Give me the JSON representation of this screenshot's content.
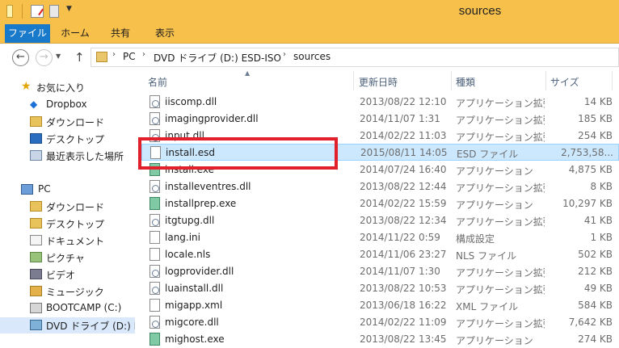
{
  "window": {
    "title": "sources"
  },
  "ribbon": {
    "tabs": [
      {
        "label": "ファイル"
      },
      {
        "label": "ホーム"
      },
      {
        "label": "共有"
      },
      {
        "label": "表示"
      }
    ]
  },
  "address": {
    "crumbs": [
      "PC",
      "DVD ドライブ (D:) ESD-ISO",
      "sources"
    ]
  },
  "nav": {
    "items": [
      {
        "label": "お気に入り",
        "icon": "star-icon"
      },
      {
        "label": "Dropbox",
        "icon": "dropbox-icon"
      },
      {
        "label": "ダウンロード",
        "icon": "folder-icon"
      },
      {
        "label": "デスクトップ",
        "icon": "desktop-icon"
      },
      {
        "label": "最近表示した場所",
        "icon": "recent-places-icon"
      },
      {
        "label": "PC",
        "icon": "pc-icon"
      },
      {
        "label": "ダウンロード",
        "icon": "folder-icon"
      },
      {
        "label": "デスクトップ",
        "icon": "desktop-icon"
      },
      {
        "label": "ドキュメント",
        "icon": "documents-icon"
      },
      {
        "label": "ピクチャ",
        "icon": "pictures-icon"
      },
      {
        "label": "ビデオ",
        "icon": "videos-icon"
      },
      {
        "label": "ミュージック",
        "icon": "music-icon"
      },
      {
        "label": "BOOTCAMP (C:)",
        "icon": "drive-icon"
      },
      {
        "label": "DVD ドライブ (D:) ES",
        "icon": "dvd-drive-icon"
      }
    ]
  },
  "columns": {
    "name": "名前",
    "date": "更新日時",
    "type": "種類",
    "size": "サイズ"
  },
  "files": [
    {
      "name": "iiscomp.dll",
      "date": "2013/08/22 12:10",
      "type": "アプリケーション拡張",
      "size": "14 KB",
      "icon": "dll"
    },
    {
      "name": "imagingprovider.dll",
      "date": "2014/11/07 1:31",
      "type": "アプリケーション拡張",
      "size": "185 KB",
      "icon": "dll"
    },
    {
      "name": "input.dll",
      "date": "2014/02/22 11:03",
      "type": "アプリケーション拡張",
      "size": "254 KB",
      "icon": "dll"
    },
    {
      "name": "install.esd",
      "date": "2015/08/11 14:05",
      "type": "ESD ファイル",
      "size": "2,753,58...",
      "icon": "file"
    },
    {
      "name": "install.exe",
      "date": "2014/07/24 16:40",
      "type": "アプリケーション",
      "size": "4,875 KB",
      "icon": "exe"
    },
    {
      "name": "installeventres.dll",
      "date": "2013/08/22 12:44",
      "type": "アプリケーション拡張",
      "size": "8 KB",
      "icon": "dll"
    },
    {
      "name": "installprep.exe",
      "date": "2014/02/22 15:59",
      "type": "アプリケーション",
      "size": "10,297 KB",
      "icon": "exe"
    },
    {
      "name": "itgtupg.dll",
      "date": "2013/08/22 12:34",
      "type": "アプリケーション拡張",
      "size": "41 KB",
      "icon": "dll"
    },
    {
      "name": "lang.ini",
      "date": "2014/11/22 0:59",
      "type": "構成設定",
      "size": "1 KB",
      "icon": "ini"
    },
    {
      "name": "locale.nls",
      "date": "2014/11/06 23:27",
      "type": "NLS ファイル",
      "size": "502 KB",
      "icon": "file"
    },
    {
      "name": "logprovider.dll",
      "date": "2014/11/07 1:30",
      "type": "アプリケーション拡張",
      "size": "212 KB",
      "icon": "dll"
    },
    {
      "name": "luainstall.dll",
      "date": "2013/08/22 10:53",
      "type": "アプリケーション拡張",
      "size": "49 KB",
      "icon": "dll"
    },
    {
      "name": "migapp.xml",
      "date": "2013/06/18 16:22",
      "type": "XML ファイル",
      "size": "584 KB",
      "icon": "file"
    },
    {
      "name": "migcore.dll",
      "date": "2014/02/22 11:09",
      "type": "アプリケーション拡張",
      "size": "7,642 KB",
      "icon": "dll"
    },
    {
      "name": "mighost.exe",
      "date": "2013/08/22 13:45",
      "type": "アプリケーション",
      "size": "274 KB",
      "icon": "exe"
    }
  ],
  "selected_file": "install.esd",
  "colors": {
    "accent": "#1979ca",
    "titlebar": "#f7c04b",
    "highlight": "#e2202c",
    "selection": "#cce8ff"
  }
}
